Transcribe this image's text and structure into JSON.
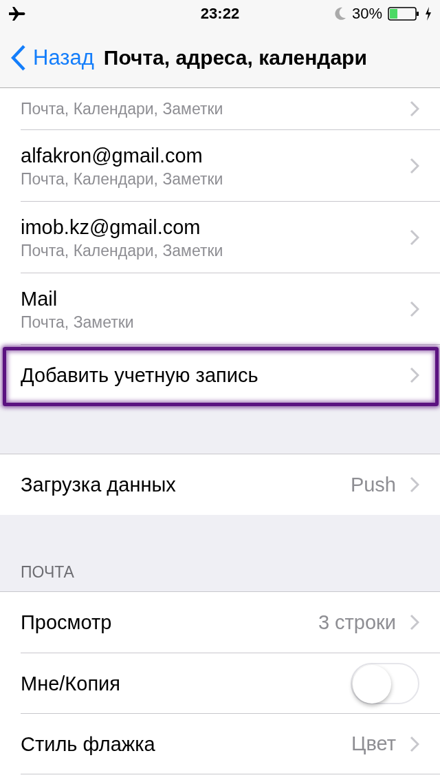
{
  "status_bar": {
    "airplane_mode": true,
    "time": "23:22",
    "do_not_disturb": true,
    "battery": "30%",
    "charging": true
  },
  "nav_bar": {
    "back": "Назад",
    "title": "Почта, адреса, календари"
  },
  "sections": [
    {
      "rows": [
        {
          "kind": "account",
          "subtitle": "Почта, Календари, Заметки"
        },
        {
          "kind": "account",
          "title": "alfakron@gmail.com",
          "subtitle": "Почта, Календари, Заметки"
        },
        {
          "kind": "account",
          "title": "imob.kz@gmail.com",
          "subtitle": "Почта, Календари, Заметки"
        },
        {
          "kind": "account",
          "title": "Mail",
          "subtitle": "Почта, Заметки"
        },
        {
          "kind": "link",
          "title": "Добавить учетную запись",
          "highlighted": true
        }
      ]
    },
    {
      "rows": [
        {
          "kind": "value",
          "title": "Загрузка данных",
          "value": "Push"
        }
      ]
    },
    {
      "header": "ПОЧТА",
      "rows": [
        {
          "kind": "value",
          "title": "Просмотр",
          "value": "3 строки"
        },
        {
          "kind": "toggle",
          "title": "Мне/Копия",
          "on": false
        },
        {
          "kind": "value",
          "title": "Стиль флажка",
          "value": "Цвет"
        }
      ]
    }
  ]
}
